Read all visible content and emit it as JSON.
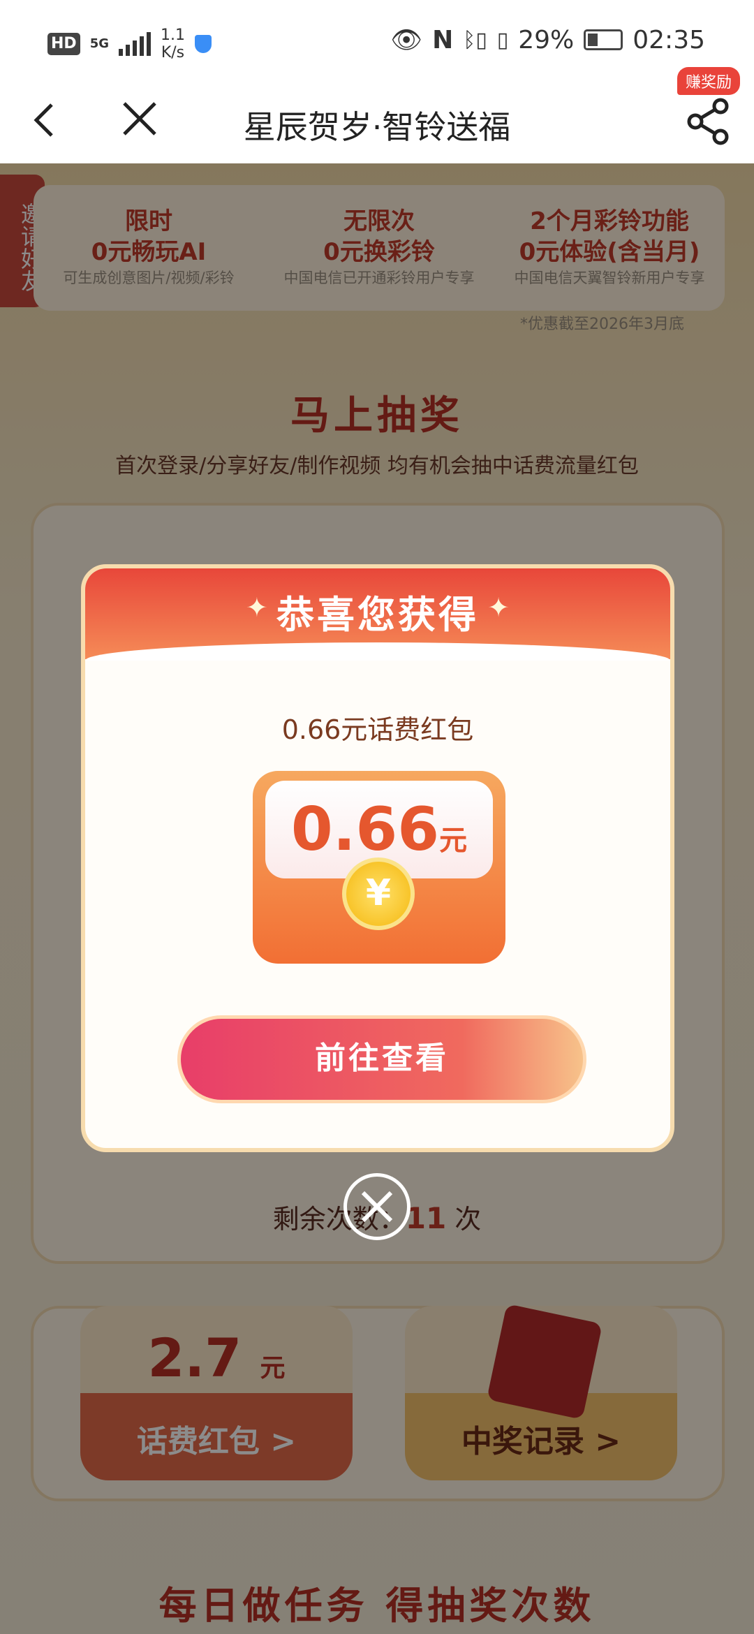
{
  "status_bar": {
    "hd": "HD",
    "network": "5G",
    "speed_value": "1.1",
    "speed_unit": "K/s",
    "battery": "29%",
    "time": "02:35"
  },
  "nav": {
    "title": "星辰贺岁·智铃送福",
    "reward_badge": "赚奖励"
  },
  "page": {
    "invite_tab": "邀请好友",
    "promos": [
      {
        "line1": "限时",
        "line2": "0元畅玩AI",
        "sub": "可生成创意图片/视频/彩铃"
      },
      {
        "line1": "无限次",
        "line2": "0元换彩铃",
        "sub": "中国电信已开通彩铃用户专享"
      },
      {
        "line1": "2个月彩铃功能",
        "line2": "0元体验(含当月)",
        "sub": "中国电信天翼智铃新用户专享"
      }
    ],
    "promo_note": "*优惠截至2026年3月底",
    "section_title": "马上抽奖",
    "section_subtitle": "首次登录/分享好友/制作视频 均有机会抽中话费流量红包",
    "remaining_label": "剩余次数：",
    "remaining_count": "11",
    "remaining_unit": "次",
    "hongbao_amount": "2.7",
    "hongbao_unit": "元",
    "hongbao_label": "话费红包 >",
    "record_label": "中奖记录 >",
    "task_title": "每日做任务 得抽奖次数"
  },
  "modal": {
    "title": "恭喜您获得",
    "prize_name": "0.66元话费红包",
    "amount": "0.66",
    "amount_unit": "元",
    "coin_symbol": "¥",
    "button_label": "前往查看"
  },
  "colors": {
    "accent_red": "#e8473a",
    "button_pink": "#e83e69",
    "gold": "#f5b80f"
  }
}
